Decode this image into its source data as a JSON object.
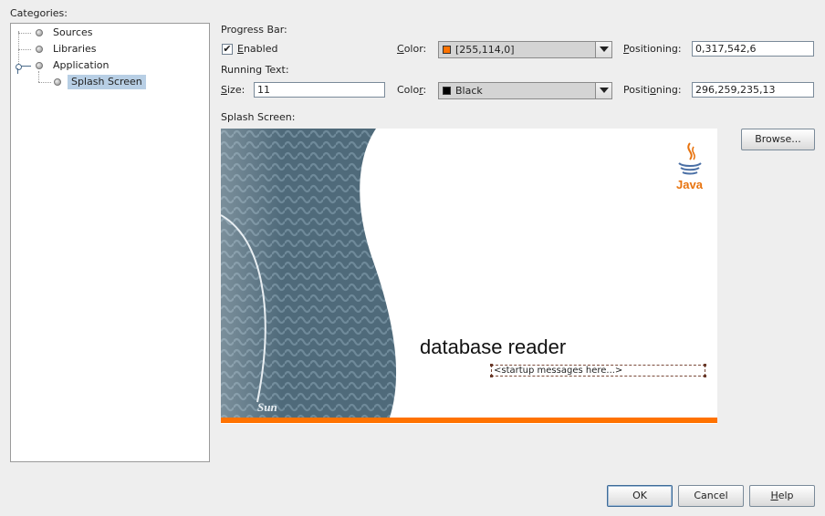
{
  "categories": {
    "label": "Categories:",
    "items": [
      {
        "label": "Sources"
      },
      {
        "label": "Libraries"
      },
      {
        "label": "Application"
      },
      {
        "label": "Splash Screen",
        "selected": true
      }
    ]
  },
  "progress_bar": {
    "section_label": "Progress Bar:",
    "enabled_label": "Enabled",
    "enabled": true,
    "color_label": "Color:",
    "color_value": "[255,114,0]",
    "color_swatch": "#ff7200",
    "positioning_label": "Positioning:",
    "positioning_value": "0,317,542,6"
  },
  "running_text": {
    "section_label": "Running Text:",
    "size_label": "Size:",
    "size_value": "11",
    "color_label": "Color:",
    "color_value": "Black",
    "color_swatch": "#000000",
    "positioning_label": "Positioning:",
    "positioning_value": "296,259,235,13"
  },
  "splash_screen": {
    "label": "Splash Screen:",
    "browse_label": "Browse...",
    "title": "database reader",
    "running_text": "<startup messages here...>",
    "sun_logo_text": "Sun",
    "java_logo_text": "Java"
  },
  "buttons": {
    "ok": "OK",
    "cancel": "Cancel",
    "help": "Help"
  }
}
